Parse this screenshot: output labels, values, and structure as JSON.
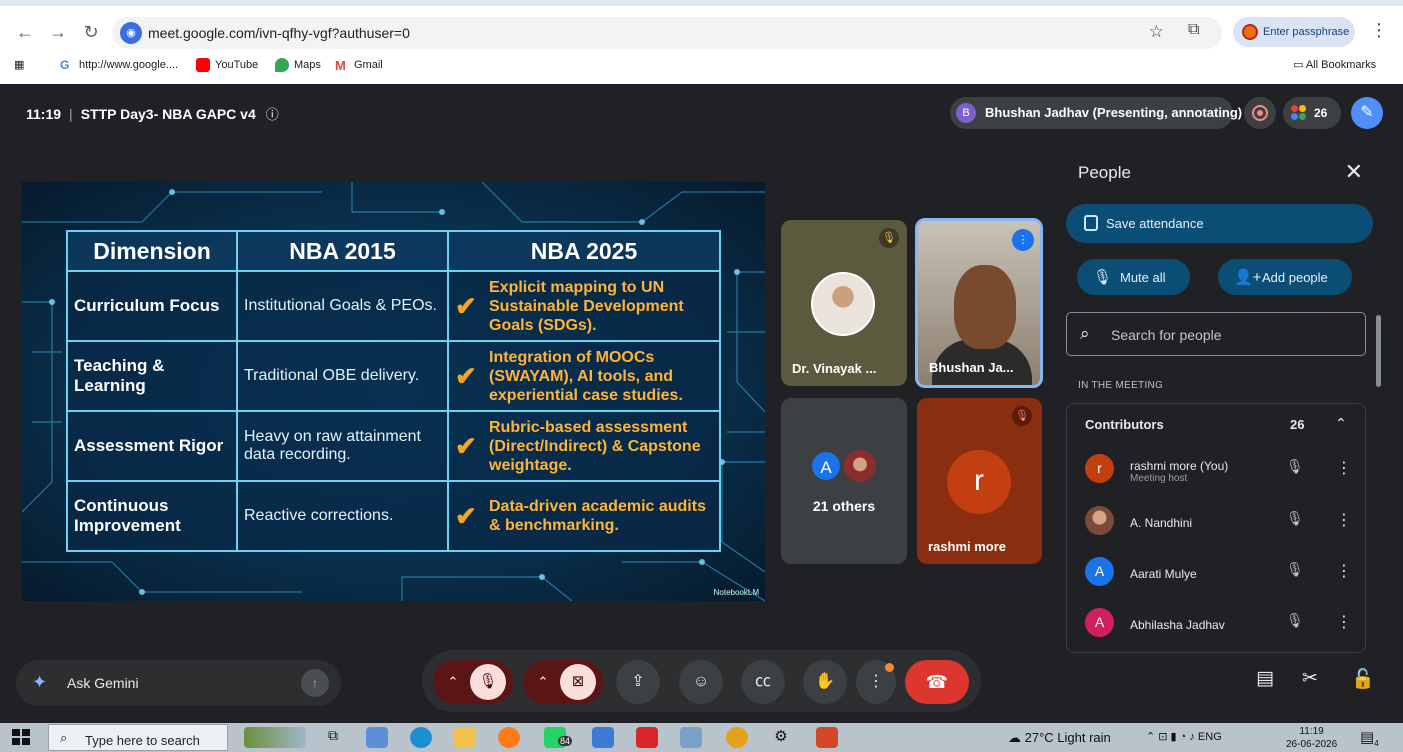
{
  "browser": {
    "url": "meet.google.com/ivn-qfhy-vgf?authuser=0",
    "passphrase_label": "Enter passphrase",
    "bookmarks": [
      {
        "label": "http://www.google....",
        "icon": "google-icon",
        "color": "#4285f4"
      },
      {
        "label": "YouTube",
        "icon": "youtube-icon",
        "color": "#ff0000"
      },
      {
        "label": "Maps",
        "icon": "maps-icon",
        "color": "#34a853"
      },
      {
        "label": "Gmail",
        "icon": "gmail-icon",
        "color": "#ea4335"
      }
    ],
    "all_bookmarks": "All Bookmarks"
  },
  "meet": {
    "time": "11:19",
    "title": "STTP Day3- NBA GAPC v4",
    "presenter_initial": "B",
    "presenter_status": "Bhushan Jadhav (Presenting, annotating)",
    "participant_count": "26"
  },
  "slide": {
    "headers": [
      "Dimension",
      "NBA 2015",
      "NBA 2025"
    ],
    "rows": [
      {
        "dimension": "Curriculum Focus",
        "nba2015": "Institutional Goals & PEOs.",
        "nba2025": "Explicit mapping to UN Sustainable Development Goals (SDGs)."
      },
      {
        "dimension": "Teaching & Learning",
        "nba2015": "Traditional OBE delivery.",
        "nba2025": "Integration of MOOCs (SWAYAM), AI tools, and experiential case studies."
      },
      {
        "dimension": "Assessment Rigor",
        "nba2015": "Heavy on raw attainment data recording.",
        "nba2025": "Rubric-based assessment (Direct/Indirect) & Capstone weightage."
      },
      {
        "dimension": "Continuous Improvement",
        "nba2015": "Reactive corrections.",
        "nba2025": "Data-driven academic audits & benchmarking."
      }
    ],
    "watermark": "NotebookLM"
  },
  "tiles": {
    "vinayak": "Dr. Vinayak ...",
    "bhushan": "Bhushan Ja...",
    "others_initial": "A",
    "others_label": "21 others",
    "rashmi_initial": "r",
    "rashmi": "rashmi more"
  },
  "people_panel": {
    "title": "People",
    "save_attendance": "Save attendance",
    "mute_all": "Mute all",
    "add_people": "Add people",
    "search_placeholder": "Search for people",
    "section_label": "IN THE MEETING",
    "contributors_label": "Contributors",
    "contributors_count": "26",
    "participants": [
      {
        "initial": "r",
        "name": "rashmi more (You)",
        "sub": "Meeting host",
        "color": "#c33f12"
      },
      {
        "initial": "",
        "name": "A. Nandhini",
        "sub": "",
        "color": "#b07a5a"
      },
      {
        "initial": "A",
        "name": "Aarati Mulye",
        "sub": "",
        "color": "#1a73e8"
      },
      {
        "initial": "A",
        "name": "Abhilasha Jadhav",
        "sub": "",
        "color": "#d0215e"
      }
    ]
  },
  "gemini": {
    "label": "Ask Gemini"
  },
  "taskbar": {
    "search_placeholder": "Type here to search",
    "whatsapp_badge": "84",
    "weather": "27°C  Light rain",
    "language": "ENG",
    "time": "11:19",
    "date": "26-06-2026",
    "notification_count": "4"
  }
}
